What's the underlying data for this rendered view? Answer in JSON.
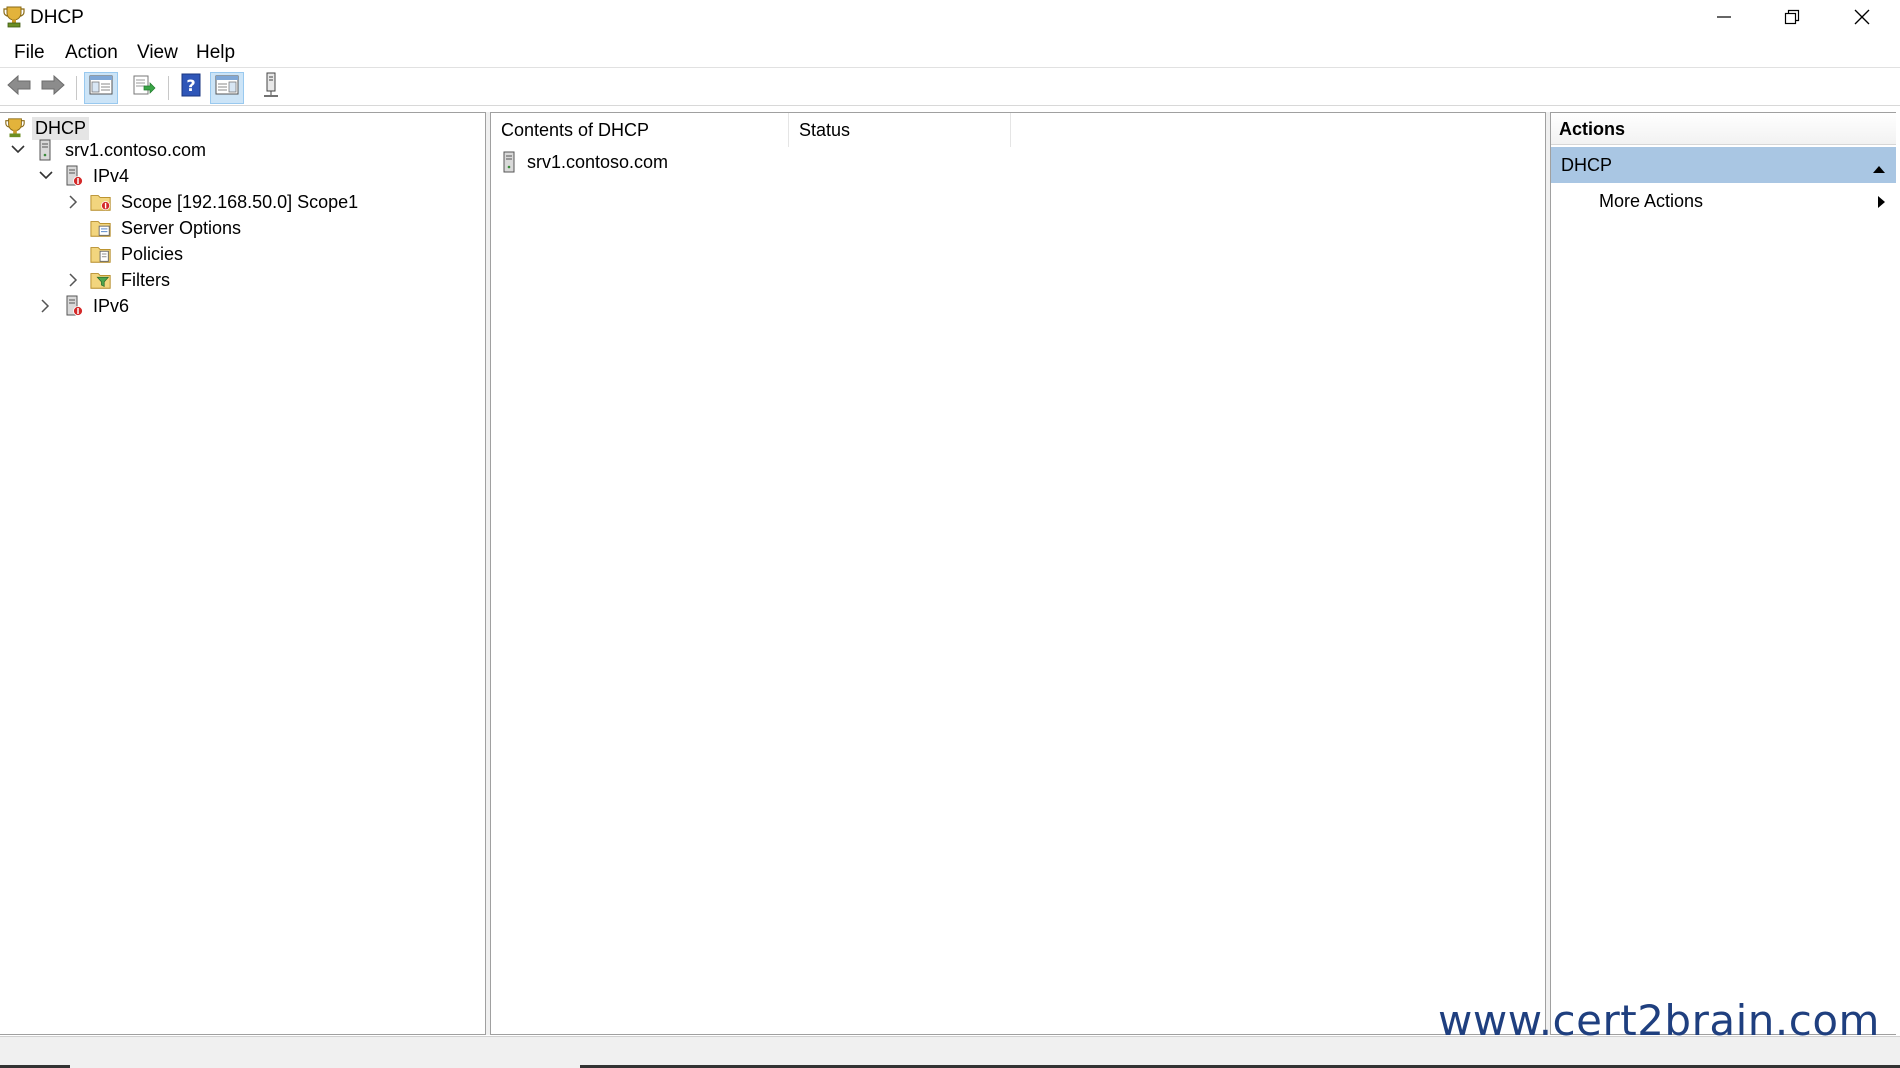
{
  "window": {
    "title": "DHCP",
    "icon": "dhcp-trophy-icon",
    "controls": [
      "minimize-icon",
      "restore-icon",
      "close-icon"
    ]
  },
  "menu": {
    "items": [
      "File",
      "Action",
      "View",
      "Help"
    ]
  },
  "toolbar": {
    "buttons": [
      {
        "icon": "back-arrow-icon",
        "active": false
      },
      {
        "icon": "forward-arrow-icon",
        "active": false
      },
      {
        "icon": "show-hide-console-tree-icon",
        "active": true
      },
      {
        "icon": "export-list-icon",
        "active": false
      },
      {
        "icon": "help-icon",
        "active": false
      },
      {
        "icon": "show-hide-action-pane-icon",
        "active": true
      },
      {
        "icon": "server-icon",
        "active": false
      }
    ]
  },
  "tree": {
    "nodes": [
      {
        "label": "DHCP",
        "icon": "dhcp-trophy-icon",
        "expander": "none",
        "selected": true
      },
      {
        "label": "srv1.contoso.com",
        "icon": "server-icon",
        "expander": "expanded"
      },
      {
        "label": "IPv4",
        "icon": "ipv4-server-icon",
        "expander": "expanded"
      },
      {
        "label": "Scope [192.168.50.0] Scope1",
        "icon": "scope-folder-icon",
        "expander": "collapsed"
      },
      {
        "label": "Server Options",
        "icon": "server-options-icon",
        "expander": "none"
      },
      {
        "label": "Policies",
        "icon": "policies-icon",
        "expander": "none"
      },
      {
        "label": "Filters",
        "icon": "filters-icon",
        "expander": "collapsed"
      },
      {
        "label": "IPv6",
        "icon": "ipv6-server-icon",
        "expander": "collapsed"
      }
    ]
  },
  "content": {
    "columns": [
      "Contents of DHCP",
      "Status"
    ],
    "rows": [
      {
        "name": "srv1.contoso.com",
        "status": "",
        "icon": "server-icon"
      }
    ]
  },
  "actions": {
    "title": "Actions",
    "group": "DHCP",
    "items": [
      "More Actions"
    ]
  },
  "watermark": "www.cert2brain.com"
}
